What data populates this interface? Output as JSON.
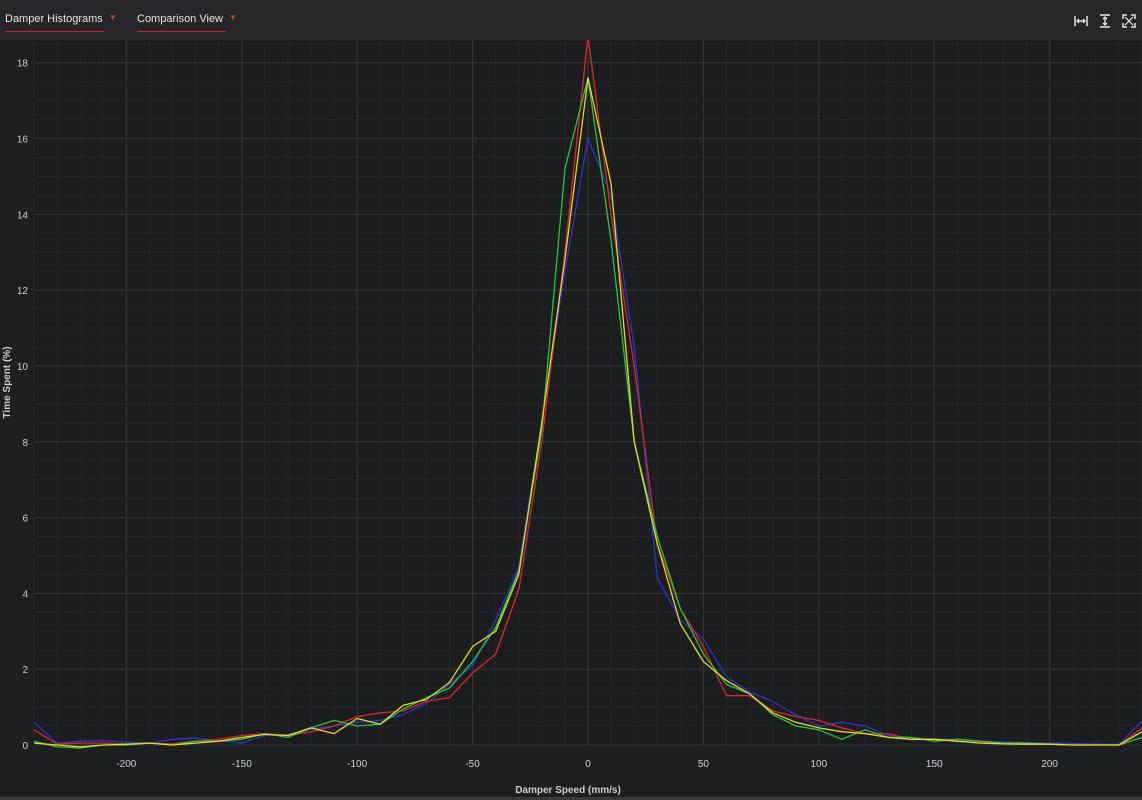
{
  "toolbar": {
    "view_dropdown": "Damper Histograms",
    "mode_dropdown": "Comparison View",
    "icons": [
      "fit-width-icon",
      "fit-height-icon",
      "fullscreen-icon"
    ]
  },
  "colors": {
    "background": "#1e1f21",
    "grid": "#2e2f32",
    "accent": "#c8242a"
  },
  "chart_data": {
    "type": "line",
    "xlabel": "Damper Speed (mm/s)",
    "ylabel": "Time Spent (%)",
    "xlim": [
      -240,
      240
    ],
    "ylim": [
      0,
      18.6
    ],
    "xticks": [
      -200,
      -150,
      -100,
      -50,
      0,
      50,
      100,
      150,
      200
    ],
    "yticks": [
      0,
      2,
      4,
      6,
      8,
      10,
      12,
      14,
      16,
      18
    ],
    "grid": true,
    "x": [
      -240,
      -230,
      -220,
      -210,
      -200,
      -190,
      -180,
      -170,
      -160,
      -150,
      -140,
      -130,
      -120,
      -110,
      -100,
      -90,
      -80,
      -70,
      -60,
      -50,
      -40,
      -30,
      -20,
      -10,
      0,
      10,
      20,
      30,
      40,
      50,
      60,
      70,
      80,
      90,
      100,
      110,
      120,
      130,
      140,
      150,
      160,
      170,
      180,
      190,
      200,
      210,
      220,
      230,
      240
    ],
    "series": [
      {
        "color": "#2a35c8",
        "values": [
          0.6,
          0.05,
          0.1,
          0.12,
          0.08,
          0.05,
          0.15,
          0.18,
          0.12,
          0.05,
          0.25,
          0.28,
          0.42,
          0.5,
          0.6,
          0.65,
          0.8,
          1.1,
          1.6,
          2.1,
          3.3,
          4.7,
          8.5,
          12.5,
          16.0,
          14.5,
          10.5,
          4.4,
          3.3,
          2.8,
          1.8,
          1.4,
          1.15,
          0.8,
          0.5,
          0.6,
          0.5,
          0.25,
          0.2,
          0.15,
          0.15,
          0.1,
          0.08,
          0.06,
          0.05,
          0.04,
          0.03,
          0.02,
          0.62
        ]
      },
      {
        "color": "#d42a2e",
        "values": [
          0.4,
          0.02,
          0.05,
          0.05,
          0.02,
          0.05,
          0.03,
          0.1,
          0.15,
          0.25,
          0.3,
          0.25,
          0.35,
          0.5,
          0.75,
          0.85,
          0.9,
          1.15,
          1.25,
          1.9,
          2.4,
          4.1,
          8.0,
          13.0,
          18.7,
          14.0,
          10.0,
          5.3,
          3.6,
          2.6,
          1.3,
          1.3,
          0.9,
          0.75,
          0.65,
          0.45,
          0.3,
          0.3,
          0.15,
          0.15,
          0.1,
          0.06,
          0.05,
          0.03,
          0.02,
          0.0,
          0.0,
          0.0,
          0.45
        ]
      },
      {
        "color": "#2ec23a",
        "values": [
          0.1,
          -0.05,
          -0.08,
          0.0,
          0.0,
          0.05,
          0.0,
          0.1,
          0.1,
          0.15,
          0.3,
          0.2,
          0.45,
          0.65,
          0.5,
          0.55,
          0.95,
          1.25,
          1.5,
          2.2,
          3.1,
          4.6,
          8.3,
          15.2,
          17.6,
          13.3,
          8.0,
          5.5,
          3.6,
          2.4,
          1.6,
          1.35,
          0.8,
          0.5,
          0.4,
          0.15,
          0.4,
          0.2,
          0.2,
          0.1,
          0.15,
          0.1,
          0.05,
          0.05,
          0.02,
          0.0,
          0.0,
          0.0,
          0.2
        ]
      },
      {
        "color": "#e4d82a",
        "values": [
          0.05,
          0.0,
          -0.05,
          0.0,
          0.02,
          0.05,
          0.0,
          0.05,
          0.1,
          0.2,
          0.28,
          0.25,
          0.45,
          0.3,
          0.7,
          0.55,
          1.05,
          1.2,
          1.65,
          2.6,
          3.0,
          4.5,
          8.5,
          12.8,
          17.6,
          14.8,
          8.0,
          5.3,
          3.2,
          2.2,
          1.7,
          1.35,
          0.85,
          0.6,
          0.45,
          0.35,
          0.3,
          0.2,
          0.15,
          0.15,
          0.1,
          0.05,
          0.03,
          0.02,
          0.02,
          0.0,
          0.0,
          0.0,
          0.35
        ]
      }
    ]
  }
}
